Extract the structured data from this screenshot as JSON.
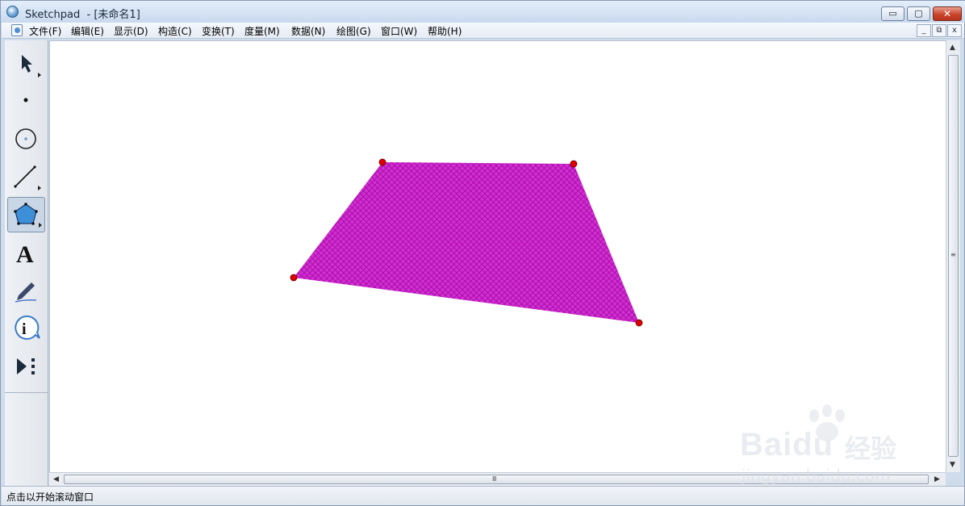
{
  "window": {
    "title": "Sketchpad  - [未命名1]",
    "controls": {
      "minimize": "▭",
      "maximize": "▢",
      "close": "✕"
    }
  },
  "menu": {
    "items": [
      "文件(F)",
      "编辑(E)",
      "显示(D)",
      "构造(C)",
      "变换(T)",
      "度量(M)",
      "数据(N)",
      "绘图(G)",
      "窗口(W)",
      "帮助(H)"
    ],
    "mdi_controls": {
      "minimize": "_",
      "restore": "⧉",
      "close": "x"
    }
  },
  "toolbox": {
    "tools": [
      {
        "name": "arrow-tool",
        "icon": "arrow-select-icon"
      },
      {
        "name": "point-tool",
        "icon": "point-icon"
      },
      {
        "name": "compass-tool",
        "icon": "circle-icon"
      },
      {
        "name": "straightedge-tool",
        "icon": "line-segment-icon"
      },
      {
        "name": "polygon-tool",
        "icon": "pentagon-icon",
        "selected": true
      },
      {
        "name": "text-tool",
        "icon": "text-a-icon",
        "label": "A"
      },
      {
        "name": "marker-tool",
        "icon": "marker-pen-icon"
      },
      {
        "name": "information-tool",
        "icon": "info-icon",
        "label": "i"
      },
      {
        "name": "custom-tool",
        "icon": "play-custom-icon"
      }
    ]
  },
  "sketch": {
    "polygon": {
      "fill_color": "#cc33cc",
      "hatch_color": "#b000b0",
      "vertex_color": "#e00000"
    }
  },
  "scrollbar": {
    "h_grip": "Ⅲ",
    "v_grip": "≡"
  },
  "status": {
    "text": "点击以开始滚动窗口"
  },
  "watermark": {
    "brand": "Bai",
    "brand_du": "du",
    "sub": "经验",
    "url": "jingyan.baidu.com"
  }
}
